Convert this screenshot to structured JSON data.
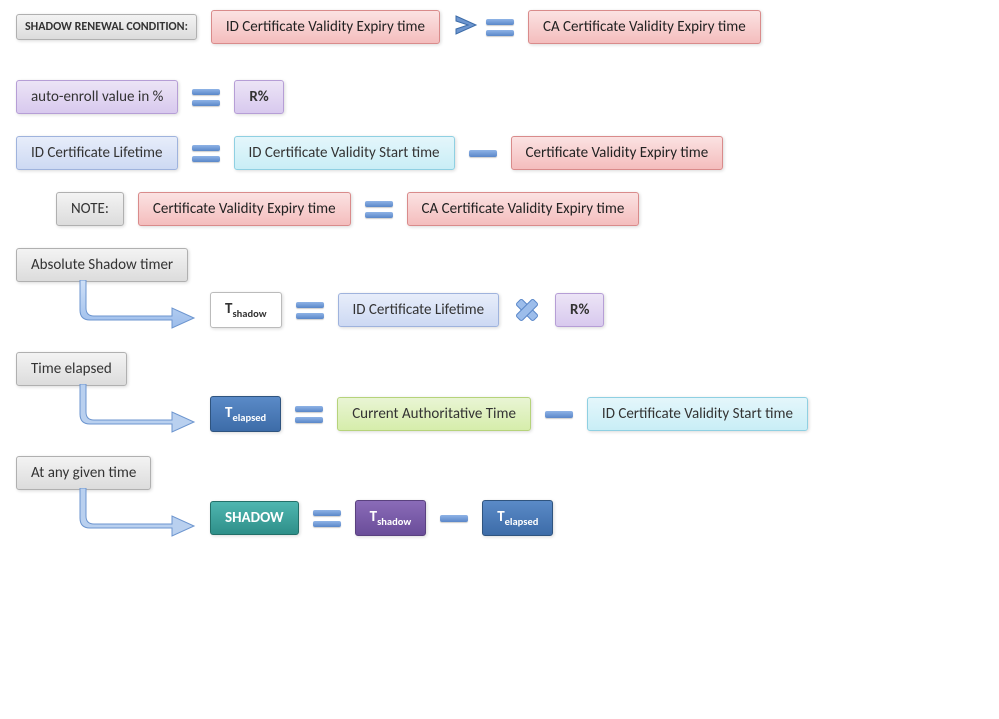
{
  "row1": {
    "condition_label": "SHADOW RENEWAL CONDITION:",
    "lhs": "ID Certificate Validity Expiry time",
    "rhs": "CA Certificate Validity Expiry time",
    "op": "ge"
  },
  "row2": {
    "label": "auto-enroll value in %",
    "op": "eq",
    "rpct": "R%"
  },
  "row3": {
    "lhs": "ID Certificate Lifetime",
    "op1": "eq",
    "mid": "ID Certificate Validity Start time",
    "op2": "minus",
    "rhs": "Certificate Validity Expiry time"
  },
  "row4": {
    "note": "NOTE:",
    "lhs": "Certificate Validity Expiry time",
    "op": "eq",
    "rhs": "CA Certificate Validity Expiry time"
  },
  "block5": {
    "header": "Absolute Shadow timer",
    "var_main": "T",
    "var_sub": "shadow",
    "op1": "eq",
    "mid": "ID Certificate Lifetime",
    "op2": "cross",
    "rhs": "R%"
  },
  "block6": {
    "header": "Time elapsed",
    "var_main": "T",
    "var_sub": "elapsed",
    "op1": "eq",
    "mid": "Current Authoritative Time",
    "op2": "minus",
    "rhs": "ID Certificate Validity Start time"
  },
  "block7": {
    "header": "At any given time",
    "var": "SHADOW",
    "op1": "eq",
    "t1_main": "T",
    "t1_sub": "shadow",
    "op2": "minus",
    "t2_main": "T",
    "t2_sub": "elapsed"
  },
  "ops": {
    "eq": "=",
    "ge": "≥",
    "minus": "−",
    "cross": "×"
  }
}
